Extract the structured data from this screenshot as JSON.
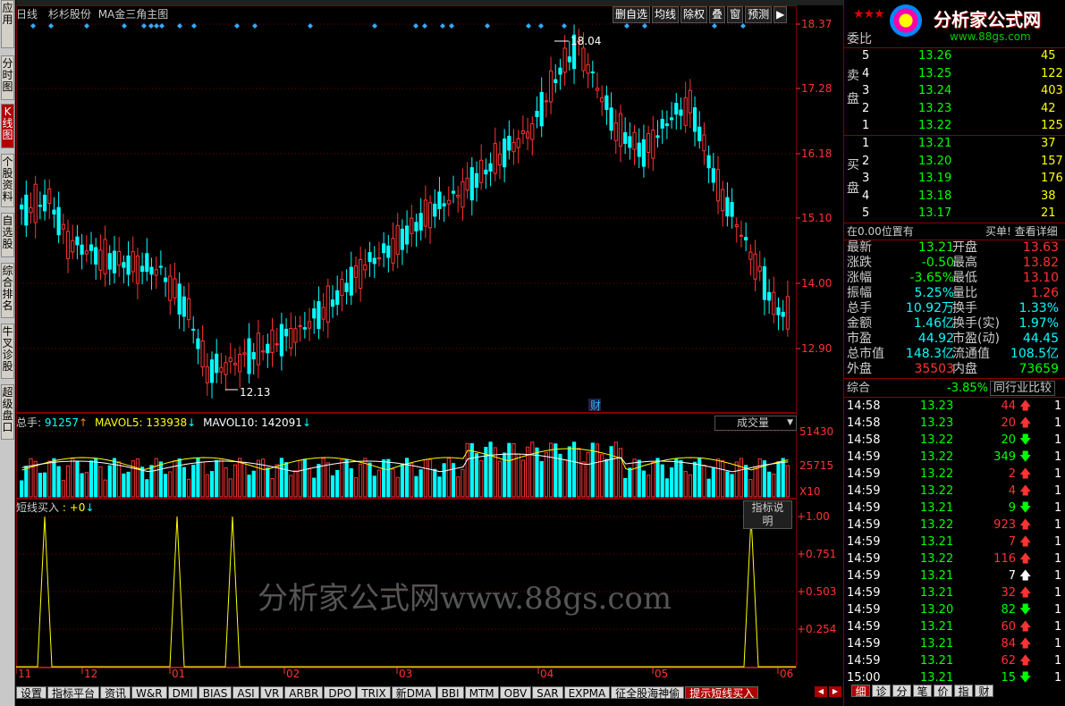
{
  "left_nav": [
    {
      "label": "应用"
    },
    {
      "label": "分时图"
    },
    {
      "label": "K线图"
    },
    {
      "label": "个股资料"
    },
    {
      "label": "自选股"
    },
    {
      "label": "综合排名"
    },
    {
      "label": "牛叉诊股"
    },
    {
      "label": "超级盘口"
    }
  ],
  "price_panel": {
    "period": "日线",
    "stock_name": "杉杉股份",
    "indicator": "MA金三角主图",
    "y_labels": [
      "18.37",
      "17.28",
      "16.18",
      "15.10",
      "14.00",
      "12.90"
    ],
    "high_label": "18.04",
    "low_label": "12.13",
    "fin_marker": "财",
    "toolbar": [
      "删自选",
      "均线",
      "除权",
      "叠",
      "窗",
      "预测",
      "▶"
    ]
  },
  "volume_panel": {
    "total_label": "总手: ",
    "total_value": "91257",
    "mavol5_label": "MAVOL5: ",
    "mavol5_value": "133938",
    "mavol10_label": "MAVOL10: ",
    "mavol10_value": "142091",
    "dropdown": "成交量",
    "y_labels": [
      "51430",
      "25715"
    ],
    "unit": "X10"
  },
  "indicator_panel": {
    "name": "短线买入",
    "value": " : +0",
    "button": "指标说明",
    "y_labels": [
      "+1.00",
      "+0.751",
      "+0.503",
      "+0.254"
    ],
    "watermark": "分析家公式网www.88gs.com"
  },
  "x_axis": [
    "11",
    "12",
    "01",
    "02",
    "03",
    "04",
    "05",
    "06"
  ],
  "bottom_tabs": [
    "设置",
    "指标平台",
    "资讯",
    "W&R",
    "DMI",
    "BIAS",
    "ASI",
    "VR",
    "ARBR",
    "DPO",
    "TRIX",
    "新DMA",
    "BBI",
    "MTM",
    "OBV",
    "SAR",
    "EXPMA",
    "征全股海神偷",
    "提示短线买入"
  ],
  "active_bottom_tab": "提示短线买入",
  "chart_data": {
    "type": "candlestick",
    "y_range": [
      12.13,
      18.04
    ],
    "high": 18.04,
    "low": 12.13,
    "signals_x": [
      "11",
      "01",
      "01",
      "06"
    ],
    "indicator_range": [
      0,
      1
    ]
  },
  "right_panel": {
    "logo_brand": "分析家公式网",
    "logo_url": "www.88gs.com",
    "wb_label": "委比",
    "sell_label": [
      "卖",
      "盘"
    ],
    "buy_label": [
      "买",
      "盘"
    ],
    "asks": [
      {
        "level": "5",
        "price": "13.26",
        "vol": "45"
      },
      {
        "level": "4",
        "price": "13.25",
        "vol": "122"
      },
      {
        "level": "3",
        "price": "13.24",
        "vol": "403"
      },
      {
        "level": "2",
        "price": "13.23",
        "vol": "42"
      },
      {
        "level": "1",
        "price": "13.22",
        "vol": "125"
      }
    ],
    "bids": [
      {
        "level": "1",
        "price": "13.21",
        "vol": "37"
      },
      {
        "level": "2",
        "price": "13.20",
        "vol": "157"
      },
      {
        "level": "3",
        "price": "13.19",
        "vol": "176"
      },
      {
        "level": "4",
        "price": "13.18",
        "vol": "38"
      },
      {
        "level": "5",
        "price": "13.17",
        "vol": "21"
      }
    ],
    "pos_text": "在0.00位置有",
    "pos_link": "买单! 查看详细",
    "info": [
      {
        "l1": "最新",
        "v1": "13.21",
        "l2": "开盘",
        "v2": "13.63"
      },
      {
        "l1": "涨跌",
        "v1": "-0.50",
        "l2": "最高",
        "v2": "13.82"
      },
      {
        "l1": "涨幅",
        "v1": "-3.65%",
        "l2": "最低",
        "v2": "13.10"
      },
      {
        "l1": "振幅",
        "v1": "5.25%",
        "l2": "量比",
        "v2": "1.26"
      },
      {
        "l1": "总手",
        "v1": "10.92万",
        "l2": "换手",
        "v2": "1.33%"
      },
      {
        "l1": "金额",
        "v1": "1.46亿",
        "l2": "换手(实)",
        "v2": "1.97%"
      },
      {
        "l1": "市盈",
        "v1": "44.92",
        "l2": "市盈(动)",
        "v2": "44.45"
      },
      {
        "l1": "总市值",
        "v1": "148.3亿",
        "l2": "流通值",
        "v2": "108.5亿"
      },
      {
        "l1": "外盘",
        "v1": "35503",
        "l2": "内盘",
        "v2": "73659"
      }
    ],
    "composite_label": "综合",
    "composite_value": "-3.85%",
    "industry_button": "同行业比较",
    "ticks": [
      {
        "time": "14:58",
        "price": "13.23",
        "vol": "44",
        "dir": "up"
      },
      {
        "time": "14:58",
        "price": "13.23",
        "vol": "20",
        "dir": "up"
      },
      {
        "time": "14:58",
        "price": "13.22",
        "vol": "20",
        "dir": "down"
      },
      {
        "time": "14:59",
        "price": "13.22",
        "vol": "349",
        "dir": "down"
      },
      {
        "time": "14:59",
        "price": "13.22",
        "vol": "2",
        "dir": "up"
      },
      {
        "time": "14:59",
        "price": "13.22",
        "vol": "4",
        "dir": "up"
      },
      {
        "time": "14:59",
        "price": "13.21",
        "vol": "9",
        "dir": "down"
      },
      {
        "time": "14:59",
        "price": "13.22",
        "vol": "923",
        "dir": "up"
      },
      {
        "time": "14:59",
        "price": "13.21",
        "vol": "7",
        "dir": "up"
      },
      {
        "time": "14:59",
        "price": "13.22",
        "vol": "116",
        "dir": "up"
      },
      {
        "time": "14:59",
        "price": "13.21",
        "vol": "7",
        "dir": "neutral"
      },
      {
        "time": "14:59",
        "price": "13.21",
        "vol": "32",
        "dir": "up"
      },
      {
        "time": "14:59",
        "price": "13.20",
        "vol": "82",
        "dir": "down"
      },
      {
        "time": "14:59",
        "price": "13.21",
        "vol": "60",
        "dir": "up"
      },
      {
        "time": "14:59",
        "price": "13.21",
        "vol": "84",
        "dir": "up"
      },
      {
        "time": "14:59",
        "price": "13.21",
        "vol": "62",
        "dir": "up"
      },
      {
        "time": "15:00",
        "price": "13.21",
        "vol": "15",
        "dir": "down"
      }
    ],
    "tick_suffix": "1",
    "bottom_tabs": [
      "细",
      "诊",
      "分",
      "笔",
      "价",
      "指",
      "财"
    ]
  },
  "colors": {
    "up": "#ff3333",
    "down": "#00ffff",
    "accent": "#b00000",
    "grid": "#800000"
  }
}
